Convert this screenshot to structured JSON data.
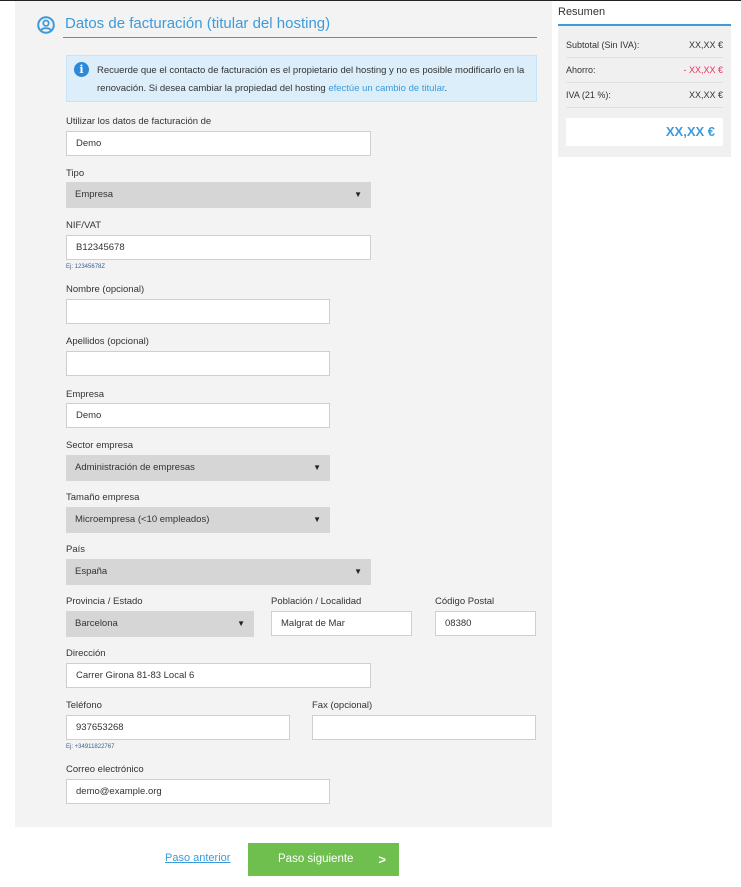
{
  "section": {
    "title": "Datos de facturación (titular del hosting)",
    "icon": "user-circle-icon",
    "accent_color": "#3d9bd9"
  },
  "notice": {
    "text": "Recuerde que el contacto de facturación es el propietario del hosting y no es posible modificarlo en la renovación. Si desea cambiar la propiedad del hosting ",
    "link": "efectúe un cambio de titular",
    "end": ".",
    "icon": "info-icon"
  },
  "form": {
    "billing_source": {
      "label": "Utilizar los datos de facturación de",
      "value": "Demo"
    },
    "type": {
      "label": "Tipo",
      "value": "Empresa"
    },
    "nif": {
      "label": "NIF/VAT",
      "value": "B12345678",
      "hint": "Ej: 12345678Z"
    },
    "first_name": {
      "label": "Nombre (opcional)",
      "value": ""
    },
    "last_name": {
      "label": "Apellidos (opcional)",
      "value": ""
    },
    "company": {
      "label": "Empresa",
      "value": "Demo"
    },
    "sector": {
      "label": "Sector empresa",
      "value": "Administración de empresas"
    },
    "size": {
      "label": "Tamaño empresa",
      "value": "Microempresa (<10 empleados)"
    },
    "country": {
      "label": "País",
      "value": "España"
    },
    "province": {
      "label": "Provincia / Estado",
      "value": "Barcelona"
    },
    "city": {
      "label": "Población / Localidad",
      "value": "Malgrat de Mar"
    },
    "postal": {
      "label": "Código Postal",
      "value": "08380"
    },
    "address": {
      "label": "Dirección",
      "value": "Carrer Girona 81-83 Local 6"
    },
    "phone": {
      "label": "Teléfono",
      "value": "937653268",
      "hint": "Ej: +34911822767"
    },
    "fax": {
      "label": "Fax (opcional)",
      "value": ""
    },
    "email": {
      "label": "Correo electrónico",
      "value": "demo@example.org"
    }
  },
  "actions": {
    "prev_label": "Paso anterior",
    "next_label": "Paso siguiente",
    "next_color": "#6fbf4f"
  },
  "summary": {
    "title": "Resumen",
    "subtotal_label": "Subtotal (Sin IVA):",
    "subtotal_value": "XX,XX €",
    "savings_label": "Ahorro:",
    "savings_value": "- XX,XX €",
    "savings_color": "#e8335f",
    "vat_label": "IVA (21 %):",
    "vat_value": "XX,XX €",
    "total_value": "XX,XX €"
  }
}
